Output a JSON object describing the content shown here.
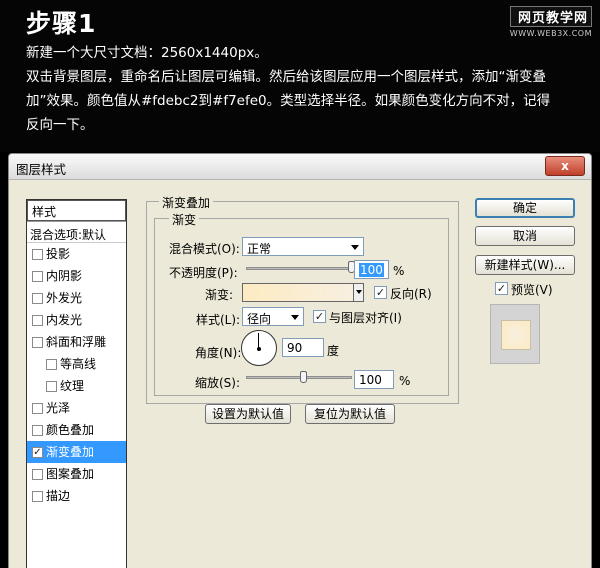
{
  "tutorial": {
    "step_title": "步骤1",
    "lines": [
      "新建一个大尺寸文档：2560x1440px。",
      "双击背景图层，重命名后让图层可编辑。然后给该图层应用一个图层样式，添加“渐变叠",
      "加”效果。颜色值从#fdebc2到#f7efe0。类型选择半径。如果颜色变化方向不对，记得",
      "反向一下。"
    ],
    "watermark": {
      "main": "网页教学网",
      "sub": "WWW.WEB3X.COM"
    }
  },
  "dialog": {
    "title": "图层样式",
    "close_label": "x",
    "styles_header": "样式",
    "blend_options": "混合选项:默认",
    "style_items": [
      {
        "label": "投影",
        "checked": false,
        "sub": false
      },
      {
        "label": "内阴影",
        "checked": false,
        "sub": false
      },
      {
        "label": "外发光",
        "checked": false,
        "sub": false
      },
      {
        "label": "内发光",
        "checked": false,
        "sub": false
      },
      {
        "label": "斜面和浮雕",
        "checked": false,
        "sub": false
      },
      {
        "label": "等高线",
        "checked": false,
        "sub": true
      },
      {
        "label": "纹理",
        "checked": false,
        "sub": true
      },
      {
        "label": "光泽",
        "checked": false,
        "sub": false
      },
      {
        "label": "颜色叠加",
        "checked": false,
        "sub": false
      },
      {
        "label": "渐变叠加",
        "checked": true,
        "sub": false,
        "selected": true
      },
      {
        "label": "图案叠加",
        "checked": false,
        "sub": false
      },
      {
        "label": "描边",
        "checked": false,
        "sub": false
      }
    ],
    "gradient_overlay": {
      "group_title": "渐变叠加",
      "inner_title": "渐变",
      "blend_mode_label": "混合模式(O):",
      "blend_mode_value": "正常",
      "opacity_label": "不透明度(P):",
      "opacity_value": "100",
      "opacity_percent": 100,
      "percent_sign": "%",
      "gradient_label": "渐变:",
      "gradient_colors": [
        "#fdebc2",
        "#f7efe0"
      ],
      "reverse_label": "反向(R)",
      "reverse_checked": true,
      "style_label": "样式(L):",
      "style_value": "径向",
      "align_label": "与图层对齐(I)",
      "align_checked": true,
      "angle_label": "角度(N):",
      "angle_value": "90",
      "angle_unit": "度",
      "scale_label": "缩放(S):",
      "scale_value": "100",
      "scale_percent": 100,
      "scale_slider_fraction": 0.55,
      "set_default": "设置为默认值",
      "reset_default": "复位为默认值"
    },
    "buttons": {
      "ok": "确定",
      "cancel": "取消",
      "new_style": "新建样式(W)...",
      "preview_label": "预览(V)",
      "preview_checked": true
    },
    "check_mark": "✓"
  }
}
